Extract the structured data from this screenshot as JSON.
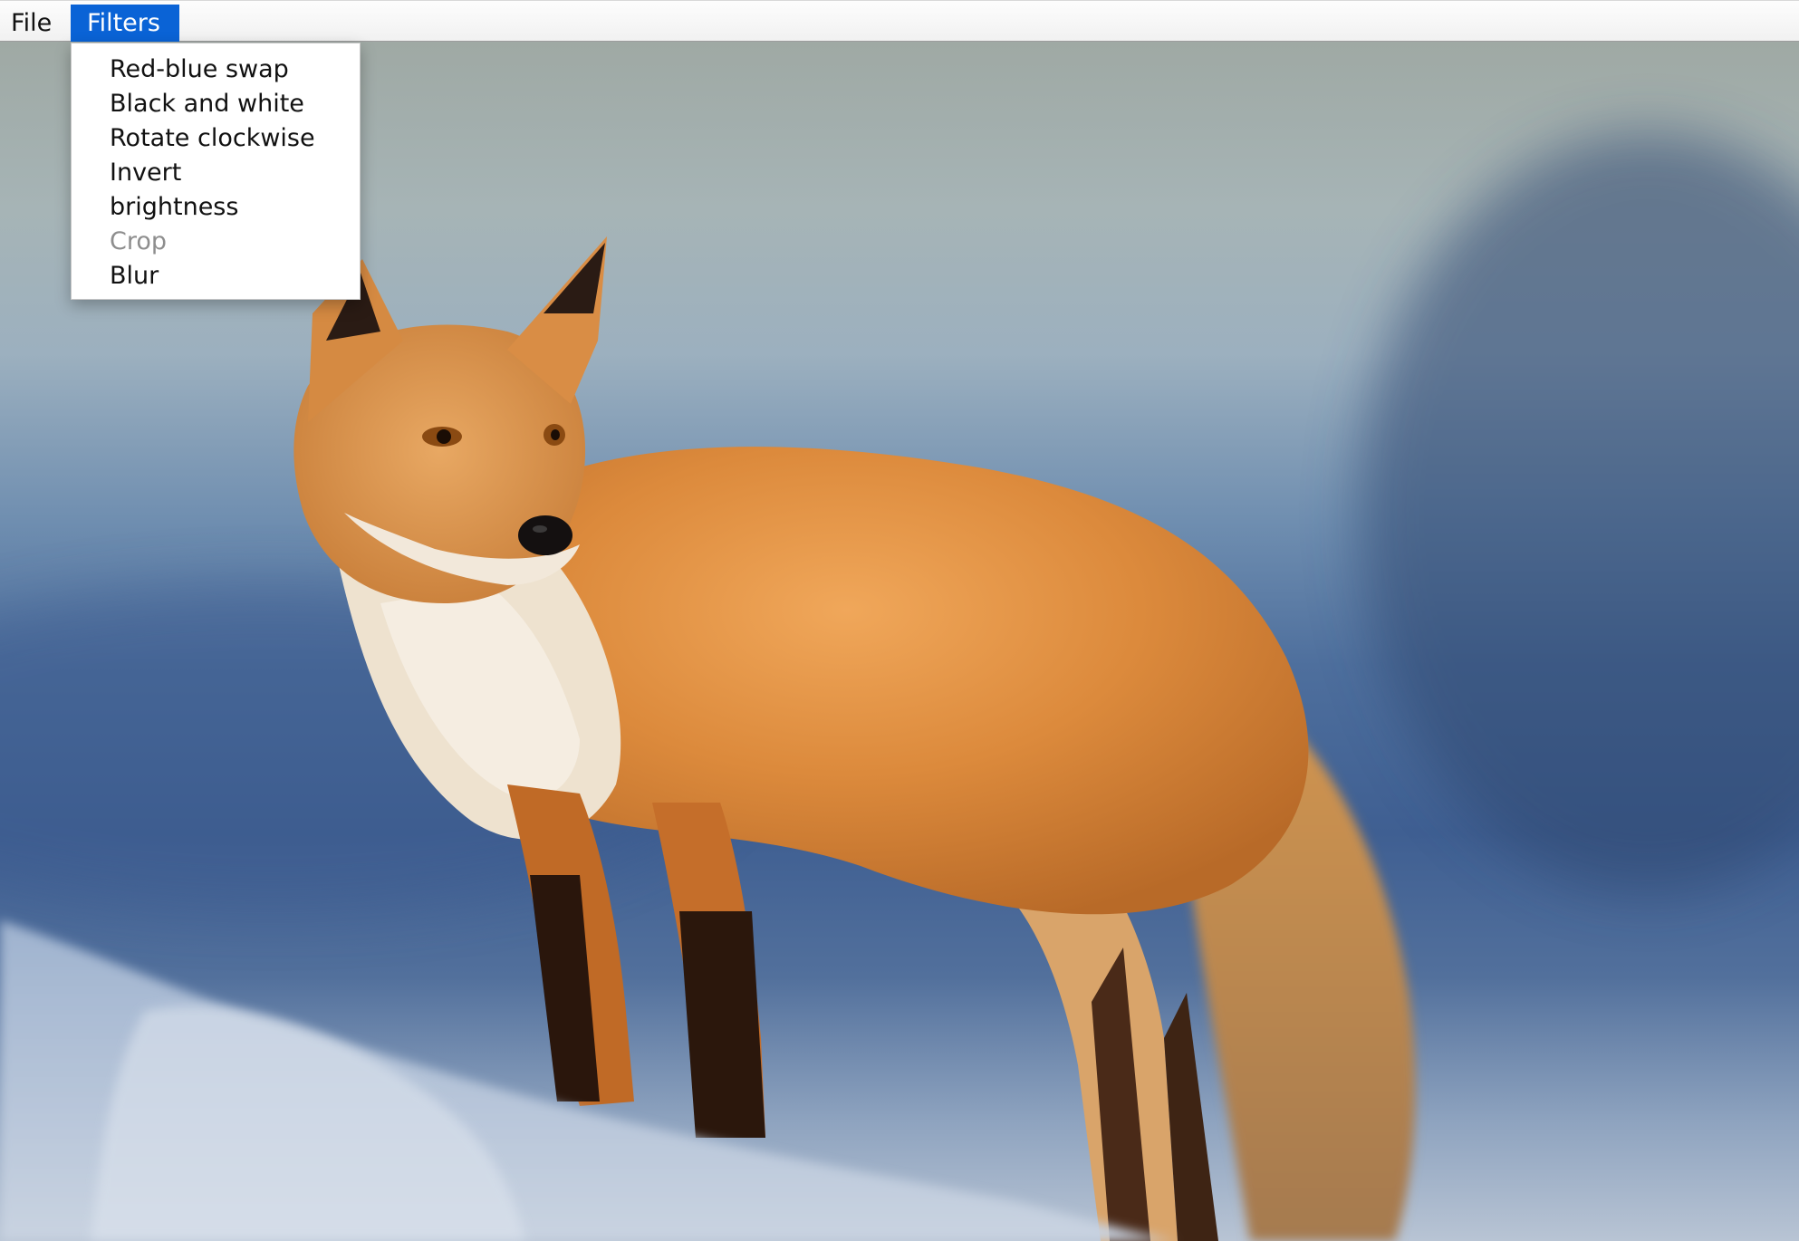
{
  "menubar": {
    "file_label": "File",
    "filters_label": "Filters",
    "active_menu": "Filters",
    "active_color": "#0a63d6"
  },
  "filters_menu": {
    "items": [
      {
        "label": "Red-blue swap",
        "enabled": true
      },
      {
        "label": "Black and white",
        "enabled": true
      },
      {
        "label": "Rotate clockwise",
        "enabled": true
      },
      {
        "label": "Invert",
        "enabled": true
      },
      {
        "label": "brightness",
        "enabled": true
      },
      {
        "label": "Crop",
        "enabled": false
      },
      {
        "label": "Blur",
        "enabled": true
      }
    ]
  },
  "canvas": {
    "image_subject": "red fox standing on snow"
  }
}
